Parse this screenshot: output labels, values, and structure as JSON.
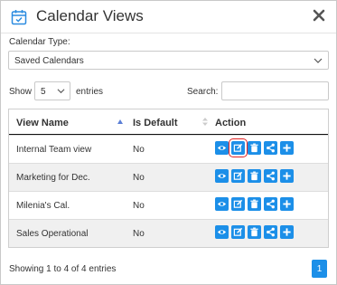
{
  "dialog": {
    "title": "Calendar Views",
    "close_icon": "close-icon",
    "calendar_icon": "calendar-check-icon"
  },
  "calendar_type": {
    "label": "Calendar Type:",
    "selected": "Saved Calendars"
  },
  "length": {
    "show_label": "Show",
    "value": "5",
    "entries_label": "entries"
  },
  "search": {
    "label": "Search:",
    "value": ""
  },
  "table": {
    "columns": [
      "View Name",
      "Is Default",
      "Action"
    ],
    "rows": [
      {
        "name": "Internal Team view",
        "is_default": "No"
      },
      {
        "name": "Marketing for Dec.",
        "is_default": "No"
      },
      {
        "name": "Milenia's Cal.",
        "is_default": "No"
      },
      {
        "name": "Sales Operational",
        "is_default": "No"
      }
    ],
    "action_icons": [
      "view-icon",
      "edit-icon",
      "delete-icon",
      "share-icon",
      "add-icon"
    ]
  },
  "footer": {
    "info": "Showing 1 to 4 of 4 entries",
    "page": "1"
  },
  "colors": {
    "accent": "#1c8fe8",
    "highlight": "#e12121",
    "row_stripe": "#f0f0f0"
  }
}
